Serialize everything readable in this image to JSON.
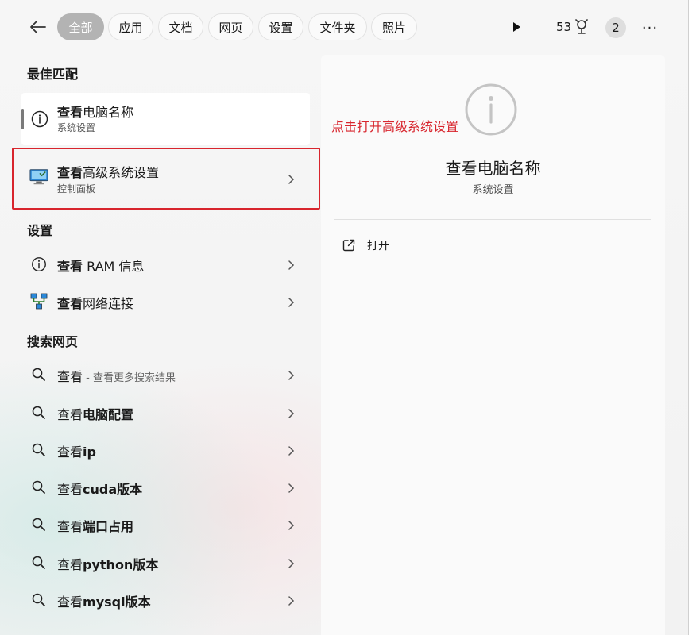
{
  "tabs": [
    {
      "label": "全部",
      "active": true
    },
    {
      "label": "应用",
      "active": false
    },
    {
      "label": "文档",
      "active": false
    },
    {
      "label": "网页",
      "active": false
    },
    {
      "label": "设置",
      "active": false
    },
    {
      "label": "文件夹",
      "active": false
    },
    {
      "label": "照片",
      "active": false
    }
  ],
  "toolbar": {
    "points": "53",
    "badge": "2",
    "more": "···"
  },
  "best_match": {
    "title": "最佳匹配",
    "items": [
      {
        "bold": "查看",
        "rest": "电脑名称",
        "sub": "系统设置",
        "icon": "info-icon"
      },
      {
        "bold": "查看",
        "rest": "高级系统设置",
        "sub": "控制面板",
        "icon": "computer-icon"
      }
    ]
  },
  "settings": {
    "title": "设置",
    "items": [
      {
        "bold": "查看",
        "rest": " RAM 信息",
        "icon": "info-icon"
      },
      {
        "bold": "查看",
        "rest": "网络连接",
        "icon": "network-icon"
      }
    ]
  },
  "web": {
    "title": "搜索网页",
    "first": {
      "normal": "查看",
      "sub": " - 查看更多搜索结果"
    },
    "items": [
      {
        "normal": "查看",
        "bold": "电脑配置"
      },
      {
        "normal": "查看",
        "bold": "ip"
      },
      {
        "normal": "查看",
        "bold": "cuda版本"
      },
      {
        "normal": "查看",
        "bold": "端口占用"
      },
      {
        "normal": "查看",
        "bold": "python版本"
      },
      {
        "normal": "查看",
        "bold": "mysql版本"
      }
    ]
  },
  "preview": {
    "annotation": "点击打开高级系统设置",
    "title": "查看电脑名称",
    "subtitle": "系统设置",
    "open_label": "打开"
  },
  "colors": {
    "annotation": "#d8252d",
    "active_tab": "#b3b3b3"
  }
}
